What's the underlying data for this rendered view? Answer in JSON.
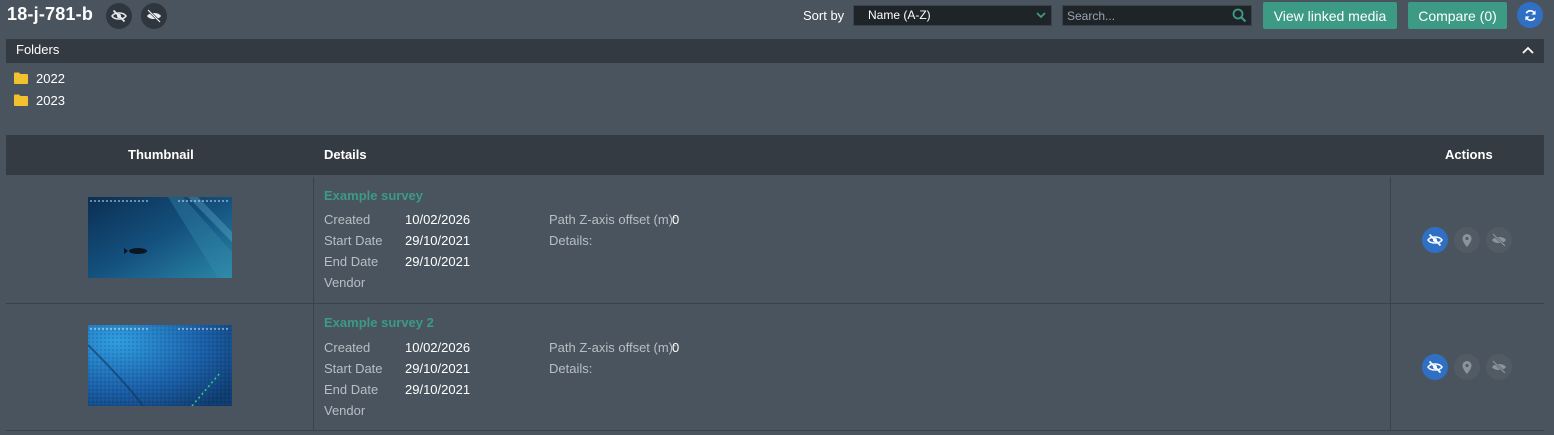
{
  "header": {
    "title": "18-j-781-b",
    "sort_label": "Sort by",
    "sort_value": "Name (A-Z)",
    "search_placeholder": "Search...",
    "view_linked_media": "View linked media",
    "compare": "Compare (0)"
  },
  "folders": {
    "title": "Folders",
    "items": [
      {
        "label": "2022"
      },
      {
        "label": "2023"
      }
    ]
  },
  "table": {
    "columns": {
      "thumbnail": "Thumbnail",
      "details": "Details",
      "actions": "Actions"
    },
    "field_labels": {
      "created": "Created",
      "start_date": "Start Date",
      "end_date": "End Date",
      "vendor": "Vendor",
      "z_offset": "Path Z-axis offset (m):",
      "details": "Details:"
    },
    "rows": [
      {
        "name": "Example survey",
        "created": "10/02/2026",
        "start_date": "29/10/2021",
        "end_date": "29/10/2021",
        "vendor": "",
        "z_offset": "0",
        "details": ""
      },
      {
        "name": "Example survey 2",
        "created": "10/02/2026",
        "start_date": "29/10/2021",
        "end_date": "29/10/2021",
        "vendor": "",
        "z_offset": "0",
        "details": ""
      }
    ]
  },
  "icons": {
    "visibility": "eye-off-icon",
    "location": "map-pin-icon",
    "hide": "eye-slash-icon",
    "folder": "folder-icon",
    "refresh": "refresh-icon",
    "search": "search-icon"
  },
  "colors": {
    "accent_green": "#3c9a85",
    "accent_blue": "#2f6fc4",
    "folder_yellow": "#f2c12e"
  }
}
